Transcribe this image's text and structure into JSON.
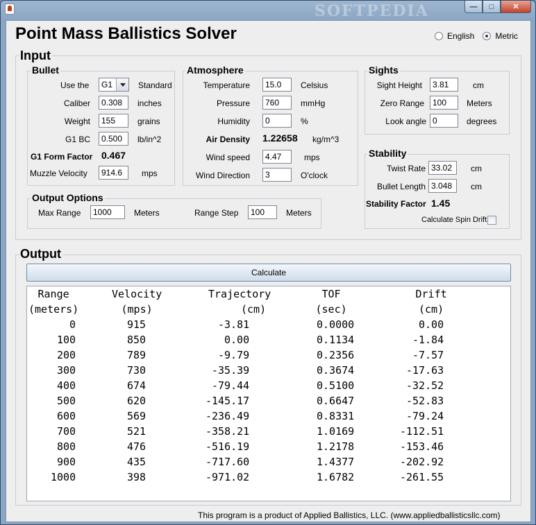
{
  "window": {
    "watermark": "SOFTPEDIA",
    "minimize_icon": "minimize-icon",
    "maximize_icon": "maximize-icon",
    "close_icon": "close-icon"
  },
  "app_title": "Point Mass Ballistics Solver",
  "units": {
    "english_label": "English",
    "metric_label": "Metric",
    "selected": "Metric"
  },
  "input": {
    "title": "Input",
    "bullet": {
      "title": "Bullet",
      "use_the_label": "Use the",
      "drag_model_value": "G1",
      "standard_label": "Standard",
      "caliber_label": "Caliber",
      "caliber_value": "0.308",
      "caliber_unit": "inches",
      "weight_label": "Weight",
      "weight_value": "155",
      "weight_unit": "grains",
      "bc_label": "G1 BC",
      "bc_value": "0.500",
      "bc_unit": "lb/in^2",
      "form_factor_label": "G1 Form Factor",
      "form_factor_value": "0.467",
      "muzzle_velocity_label": "Muzzle Velocity",
      "muzzle_velocity_value": "914.6",
      "muzzle_velocity_unit": "mps"
    },
    "atmosphere": {
      "title": "Atmosphere",
      "temperature_label": "Temperature",
      "temperature_value": "15.0",
      "temperature_unit": "Celsius",
      "pressure_label": "Pressure",
      "pressure_value": "760",
      "pressure_unit": "mmHg",
      "humidity_label": "Humidity",
      "humidity_value": "0",
      "humidity_unit": "%",
      "air_density_label": "Air Density",
      "air_density_value": "1.22658",
      "air_density_unit": "kg/m^3",
      "wind_speed_label": "Wind speed",
      "wind_speed_value": "4.47",
      "wind_speed_unit": "mps",
      "wind_direction_label": "Wind Direction",
      "wind_direction_value": "3",
      "wind_direction_unit": "O'clock"
    },
    "sights": {
      "title": "Sights",
      "sight_height_label": "Sight Height",
      "sight_height_value": "3.81",
      "sight_height_unit": "cm",
      "zero_range_label": "Zero Range",
      "zero_range_value": "100",
      "zero_range_unit": "Meters",
      "look_angle_label": "Look angle",
      "look_angle_value": "0",
      "look_angle_unit": "degrees"
    },
    "stability": {
      "title": "Stability",
      "twist_rate_label": "Twist Rate",
      "twist_rate_value": "33.02",
      "twist_rate_unit": "cm",
      "bullet_length_label": "Bullet Length",
      "bullet_length_value": "3.048",
      "bullet_length_unit": "cm",
      "stability_factor_label": "Stability Factor",
      "stability_factor_value": "1.45",
      "spin_drift_label": "Calculate Spin Drift",
      "spin_drift_checked": false
    },
    "output_options": {
      "title": "Output Options",
      "max_range_label": "Max Range",
      "max_range_value": "1000",
      "max_range_unit": "Meters",
      "range_step_label": "Range Step",
      "range_step_value": "100",
      "range_step_unit": "Meters"
    }
  },
  "output": {
    "title": "Output",
    "calculate_label": "Calculate",
    "columns": [
      {
        "header": "Range",
        "unit": "(meters)"
      },
      {
        "header": "Velocity",
        "unit": "(mps)"
      },
      {
        "header": "Trajectory",
        "unit": "(cm)"
      },
      {
        "header": "TOF",
        "unit": "(sec)"
      },
      {
        "header": "Drift",
        "unit": "(cm)"
      }
    ],
    "rows": [
      [
        "0",
        "915",
        "-3.81",
        "0.0000",
        "0.00"
      ],
      [
        "100",
        "850",
        "0.00",
        "0.1134",
        "-1.84"
      ],
      [
        "200",
        "789",
        "-9.79",
        "0.2356",
        "-7.57"
      ],
      [
        "300",
        "730",
        "-35.39",
        "0.3674",
        "-17.63"
      ],
      [
        "400",
        "674",
        "-79.44",
        "0.5100",
        "-32.52"
      ],
      [
        "500",
        "620",
        "-145.17",
        "0.6647",
        "-52.83"
      ],
      [
        "600",
        "569",
        "-236.49",
        "0.8331",
        "-79.24"
      ],
      [
        "700",
        "521",
        "-358.21",
        "1.0169",
        "-112.51"
      ],
      [
        "800",
        "476",
        "-516.19",
        "1.2178",
        "-153.46"
      ],
      [
        "900",
        "435",
        "-717.60",
        "1.4377",
        "-202.92"
      ],
      [
        "1000",
        "398",
        "-971.02",
        "1.6782",
        "-261.55"
      ]
    ]
  },
  "footer": "This program is a product of Applied Ballistics, LLC. (www.appliedballisticsllc.com)"
}
